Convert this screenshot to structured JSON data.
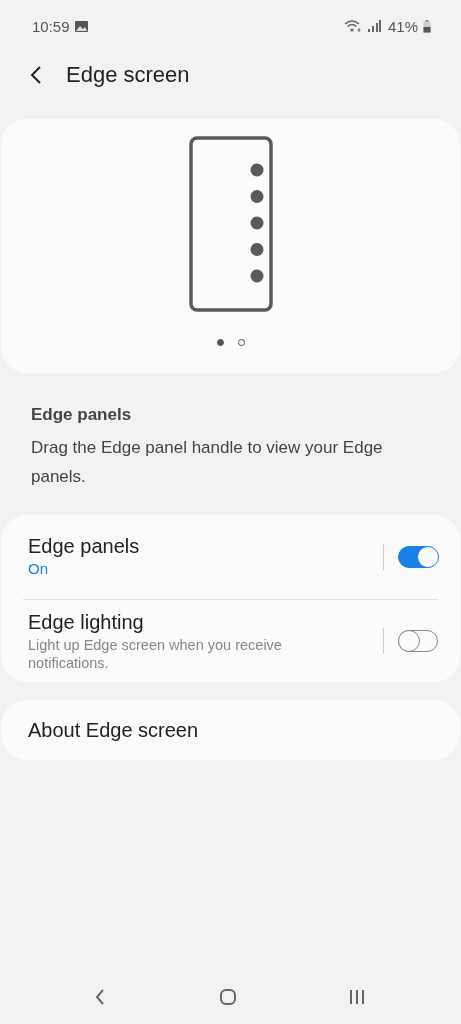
{
  "status_bar": {
    "time": "10:59",
    "battery": "41%"
  },
  "header": {
    "title": "Edge screen"
  },
  "preview": {
    "pages": [
      {
        "selected": true
      },
      {
        "selected": false
      }
    ]
  },
  "section": {
    "title": "Edge panels",
    "description": "Drag the Edge panel handle to view your Edge panels."
  },
  "settings": [
    {
      "title": "Edge panels",
      "subtitle": "On",
      "kind": "status",
      "on": true
    },
    {
      "title": "Edge lighting",
      "subtitle": "Light up Edge screen when you receive notifications.",
      "kind": "description",
      "on": false
    }
  ],
  "about": {
    "title": "About Edge screen"
  }
}
